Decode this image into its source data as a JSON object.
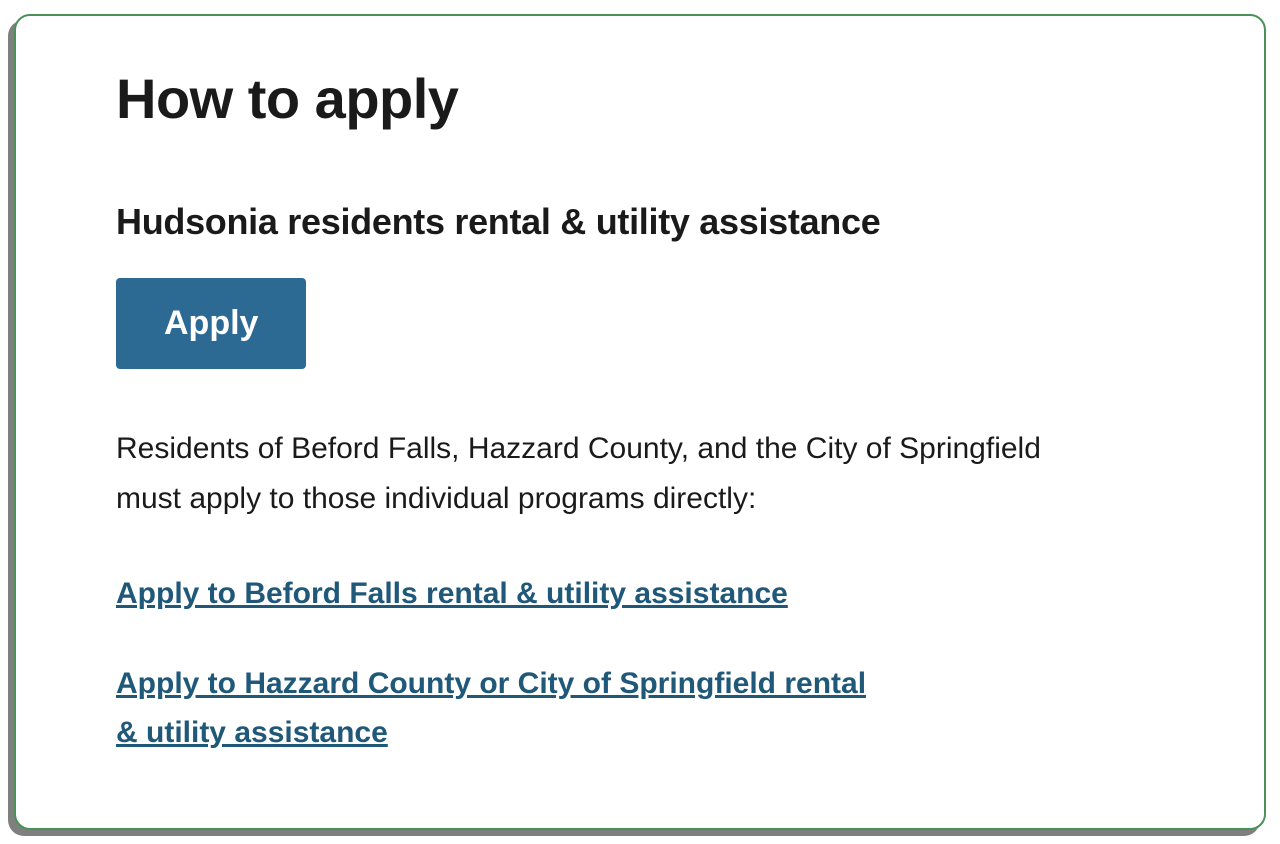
{
  "heading": "How to apply",
  "subheading": "Hudsonia residents rental & utility assistance",
  "apply_button_label": "Apply",
  "description": "Residents of Beford Falls, Hazzard County, and the City of Springfield must apply to those individual programs directly:",
  "links": {
    "beford_falls": "Apply to Beford Falls rental & utility assistance",
    "hazzard_springfield": "Apply to Hazzard County or City of Springfield rental & utility assistance"
  }
}
